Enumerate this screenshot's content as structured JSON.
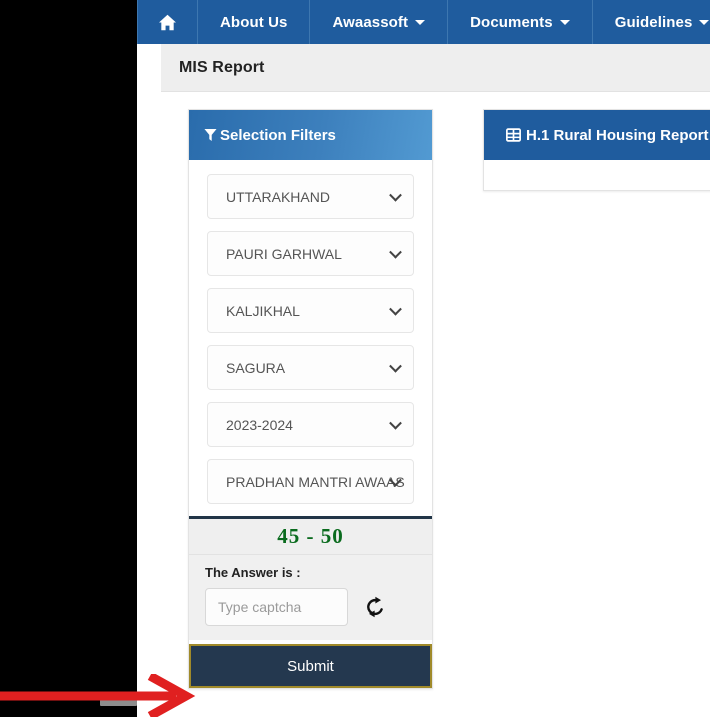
{
  "nav": {
    "items": [
      {
        "label": "",
        "icon": "home-icon",
        "caret": false
      },
      {
        "label": "About Us",
        "icon": "",
        "caret": false
      },
      {
        "label": "Awaassoft",
        "icon": "",
        "caret": true
      },
      {
        "label": "Documents",
        "icon": "",
        "caret": true
      },
      {
        "label": "Guidelines",
        "icon": "",
        "caret": true
      }
    ],
    "background": "#1f5c9e"
  },
  "breadcrumb": {
    "title": "MIS Report"
  },
  "filters": {
    "header": "Selection Filters",
    "header_icon": "funnel-icon",
    "selects": [
      {
        "name": "state",
        "value": "UTTARAKHAND"
      },
      {
        "name": "district",
        "value": "PAURI GARHWAL"
      },
      {
        "name": "block",
        "value": "KALJIKHAL"
      },
      {
        "name": "panchayat",
        "value": "SAGURA"
      },
      {
        "name": "financial-year",
        "value": "2023-2024"
      },
      {
        "name": "scheme",
        "value": "PRADHAN MANTRI AWAAS"
      }
    ],
    "captcha": {
      "challenge": "45 - 50",
      "label": "The Answer is :",
      "placeholder": "Type captcha",
      "value": "",
      "refresh_icon": "refresh-icon",
      "challenge_color": "#0a6b1e"
    },
    "submit_label": "Submit",
    "submit_color": "#24384f",
    "submit_border_color": "#a08a2a"
  },
  "report_panel": {
    "header": "H.1 Rural Housing Report",
    "header_icon": "table-grid-icon",
    "header_color": "#1f5c9e"
  },
  "annotation": {
    "arrow": "red-arrow-pointing-to-submit",
    "color": "#e02020"
  }
}
